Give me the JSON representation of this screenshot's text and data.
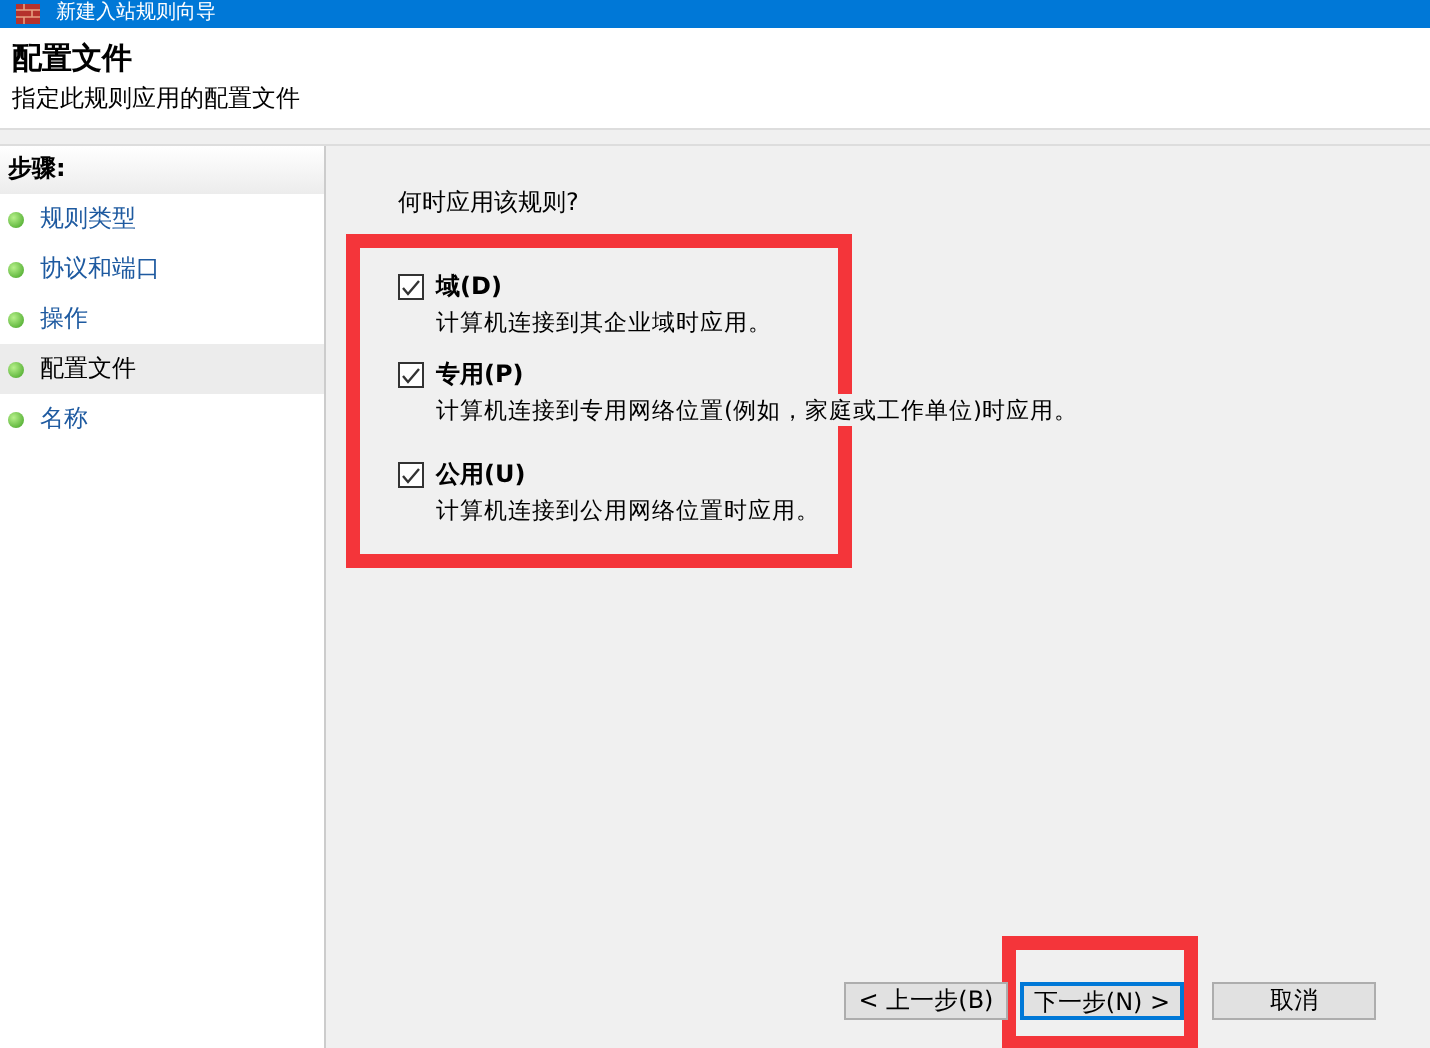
{
  "window": {
    "title": "新建入站规则向导"
  },
  "header": {
    "title": "配置文件",
    "subtitle": "指定此规则应用的配置文件"
  },
  "sidebar": {
    "heading": "步骤:",
    "items": [
      {
        "label": "规则类型",
        "selected": false
      },
      {
        "label": "协议和端口",
        "selected": false
      },
      {
        "label": "操作",
        "selected": false
      },
      {
        "label": "配置文件",
        "selected": true
      },
      {
        "label": "名称",
        "selected": false
      }
    ]
  },
  "question": "何时应用该规则?",
  "options": [
    {
      "label": "域(D)",
      "description": "计算机连接到其企业域时应用。",
      "checked": true
    },
    {
      "label": "专用(P)",
      "description": "计算机连接到专用网络位置(例如，家庭或工作单位)时应用。",
      "checked": true
    },
    {
      "label": "公用(U)",
      "description": "计算机连接到公用网络位置时应用。",
      "checked": true
    }
  ],
  "buttons": [
    {
      "label": "< 上一步(B)",
      "focused": false
    },
    {
      "label": "下一步(N) >",
      "focused": true
    },
    {
      "label": "取消",
      "focused": false
    }
  ]
}
